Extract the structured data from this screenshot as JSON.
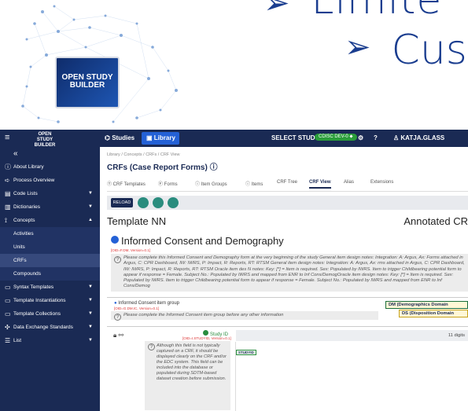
{
  "slide": {
    "bullets": [
      {
        "marker": "➢",
        "text": "Limite"
      },
      {
        "marker": "➢",
        "text": "Cus"
      }
    ],
    "product_screen_title": "OPEN STUDY BUILDER"
  },
  "topbar": {
    "menu_icon": "hamburger-icon",
    "logo_text": "OPEN STUDY BUILDER",
    "studies_label": "Studies",
    "library_label": "Library",
    "select_study_label": "SELECT STUDY",
    "cdisc_label": "CDISC DEV-0",
    "user_label": "KATJA.GLASS",
    "accent_color": "#2461d6",
    "bar_color": "#1a2a54"
  },
  "sidebar": {
    "collapse_icon": "«",
    "items": [
      {
        "label": "About Library",
        "icon": "info-icon",
        "chevron": false
      },
      {
        "label": "Process Overview",
        "icon": "arrow-icon",
        "chevron": false
      },
      {
        "label": "Code Lists",
        "icon": "folder-icon",
        "chevron": true
      },
      {
        "label": "Dictionaries",
        "icon": "book-icon",
        "chevron": true
      },
      {
        "label": "Concepts",
        "icon": "hierarchy-icon",
        "chevron": true
      },
      {
        "label": "Activities",
        "sub": true
      },
      {
        "label": "Units",
        "sub": true
      },
      {
        "label": "CRFs",
        "sub": true,
        "active": true
      },
      {
        "label": "Compounds",
        "sub": true
      },
      {
        "label": "Syntax Templates",
        "icon": "template-icon",
        "chevron": true
      },
      {
        "label": "Template Instantiations",
        "icon": "template-icon",
        "chevron": true
      },
      {
        "label": "Template Collections",
        "icon": "template-icon",
        "chevron": true
      },
      {
        "label": "Data Exchange Standards",
        "icon": "exchange-icon",
        "chevron": true
      },
      {
        "label": "List",
        "icon": "list-icon",
        "chevron": true
      }
    ]
  },
  "main": {
    "breadcrumb": "Library / Concepts / CRFs / CRF View",
    "title": "CRFs (Case Report Forms)",
    "tabs": [
      "CRF Templates",
      "Forms",
      "Item Groups",
      "Items",
      "CRF Tree",
      "CRF View",
      "Alias",
      "Extensions"
    ],
    "active_tab": "CRF View",
    "reload_label": "RELOAD",
    "template_name": "Template NN",
    "annotated_label": "Annotated CR",
    "form": {
      "title": "Informed Consent and Demography",
      "oid": "[OID=F.DM, Version=0.1]",
      "description": "Please complete this Informed Consent and Demography form at the very beginning of the study General item design notes: Integration: A: Argus, Ax: Forms attached in Argus, C: CPR Dashboard, IW: IWRS, P: Impact, R: Reports, RT: RTSM General item design notes: Integration: A: Argus, Ax: rms attached in Argus, C: CPR Dashboard, IW: IWRS, P: Impact, R: Reports, RT: RTSM Oracle item des N notes: Key: [*] = Item is required. Sex: Populated by IWRS. Item to trigger Childbearing potential form to appear if response = Female. Subject No.: Populated by IWRS and mapped from ENR to Inf Cons/DemogOracle item design notes: Key: [*] = Item is required. Sex: Populated by IWRS. Item to trigger Childbearing potential form to appear if response = Female. Subject No.: Populated by IWRS and mapped from ENR to Inf Cons/Demog"
    },
    "item_group": {
      "title": "Informed Consent item group",
      "oid": "[OID=G.DM.IC, Version=0.1]",
      "description": "Please complete the Informed Consent item group before any other information",
      "domains": [
        "DM (Demographics Domain",
        "DS (Disposition Domain"
      ]
    },
    "item": {
      "name": "Study ID",
      "oid": "[OID=I.STUDYID, Version=0.1]",
      "note": "Although this field is not typically captured on a CRF, it should be displayed clearly on the CRF and/or the EDC system. This field can be included into the database or populated during SDTM-based dataset creation before submission.",
      "length": "11 digits",
      "sdtm_tag": "STUDYID"
    }
  }
}
